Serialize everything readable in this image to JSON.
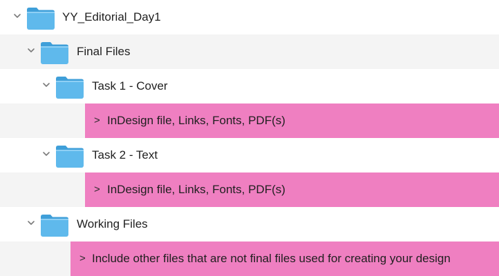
{
  "tree": {
    "root": {
      "name": "YY_Editorial_Day1",
      "icon": "folder-icon",
      "expanded": true
    },
    "final_files": {
      "name": "Final Files",
      "icon": "folder-icon",
      "expanded": true
    },
    "task1": {
      "name": "Task 1 - Cover",
      "icon": "folder-icon",
      "expanded": true,
      "note_caret": ">",
      "note": "InDesign file, Links, Fonts, PDF(s)"
    },
    "task2": {
      "name": "Task 2 - Text",
      "icon": "folder-icon",
      "expanded": true,
      "note_caret": ">",
      "note": "InDesign file, Links, Fonts, PDF(s)"
    },
    "working_files": {
      "name": "Working Files",
      "icon": "folder-icon",
      "expanded": true,
      "note_caret": ">",
      "note": "Include other files that are not final files used for creating your design"
    }
  },
  "colors": {
    "highlight": "#ef7fc1",
    "folder_body": "#5fb9ec",
    "folder_tab": "#3f9fd9",
    "alt_row": "#f4f4f4"
  }
}
